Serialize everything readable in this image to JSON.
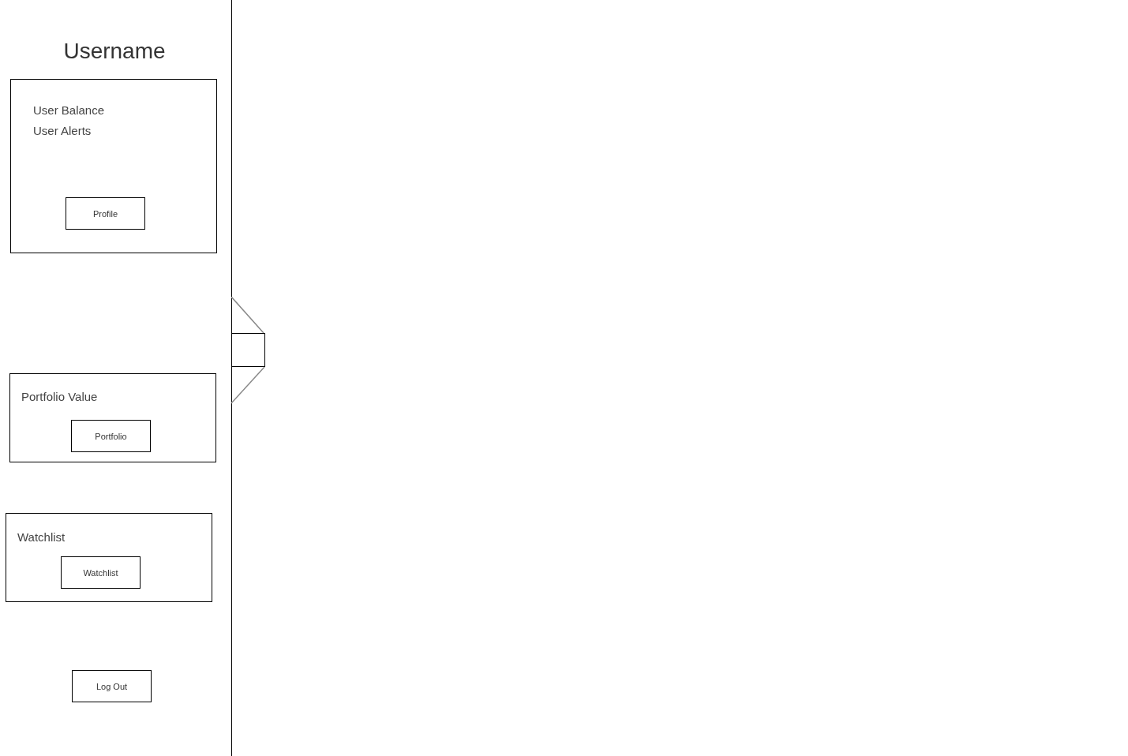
{
  "sidebar": {
    "username": "Username",
    "cards": [
      {
        "lines": [
          "User Balance",
          "User Alerts"
        ],
        "button": "Profile"
      },
      {
        "lines": [
          "Portfolio Value"
        ],
        "button": "Portfolio"
      },
      {
        "lines": [
          "Watchlist"
        ],
        "button": "Watchlist"
      }
    ],
    "logout_button": "Log Out"
  }
}
